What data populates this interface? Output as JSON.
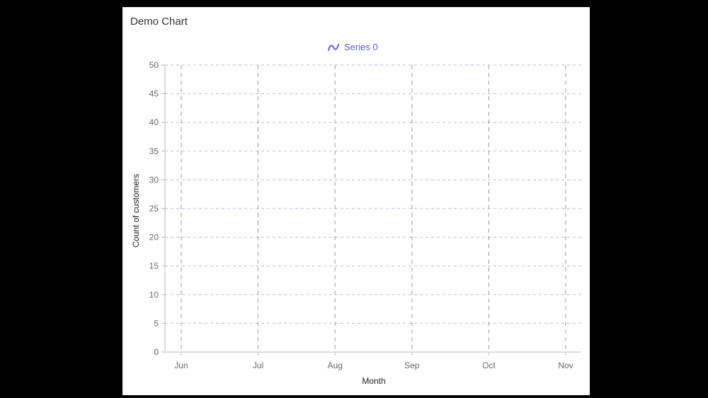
{
  "card": {
    "title": "Demo Chart"
  },
  "chart_data": {
    "type": "line",
    "categories": [
      "Jun",
      "Jul",
      "Aug",
      "Sep",
      "Oct",
      "Nov"
    ],
    "series": [
      {
        "name": "Series 0",
        "values": [],
        "color": "#5b5bd6"
      }
    ],
    "xlabel": "Month",
    "ylabel": "Count of customers",
    "ylim": [
      0,
      50
    ],
    "yticks": [
      0,
      5,
      10,
      15,
      20,
      25,
      30,
      35,
      40,
      45,
      50
    ],
    "grid": true,
    "legend_position": "top-center"
  },
  "colors": {
    "grid_h": "#b9b9e6",
    "grid_v": "#9a9a9a",
    "axis": "#bbbbbb",
    "legend": "#5b5bd6"
  },
  "icons": {
    "legend_marker": "wave-line-icon"
  }
}
